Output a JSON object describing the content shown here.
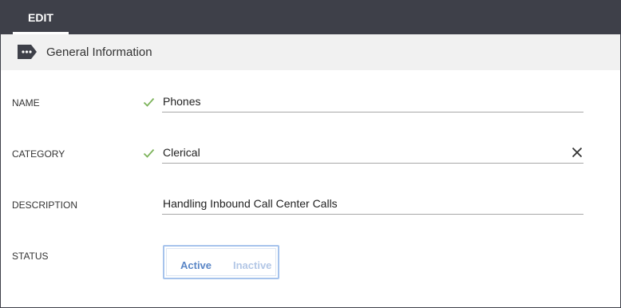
{
  "tabs": {
    "edit": "EDIT"
  },
  "section": {
    "title": "General Information",
    "icon": "tag-icon"
  },
  "form": {
    "name": {
      "label": "NAME",
      "value": "Phones",
      "valid": true
    },
    "category": {
      "label": "CATEGORY",
      "value": "Clerical",
      "valid": true,
      "clear_icon": "close-icon"
    },
    "description": {
      "label": "DESCRIPTION",
      "value": "Handling Inbound Call Center Calls"
    },
    "status": {
      "label": "STATUS",
      "options": [
        "Active",
        "Inactive"
      ],
      "selected": "Active"
    }
  },
  "colors": {
    "topbar": "#3e4049",
    "header_bg": "#f1f1f1",
    "check": "#7cb35a",
    "toggle_border": "#a6c3ec",
    "active_text": "#5a86c6",
    "inactive_text": "#b3c7e6"
  }
}
